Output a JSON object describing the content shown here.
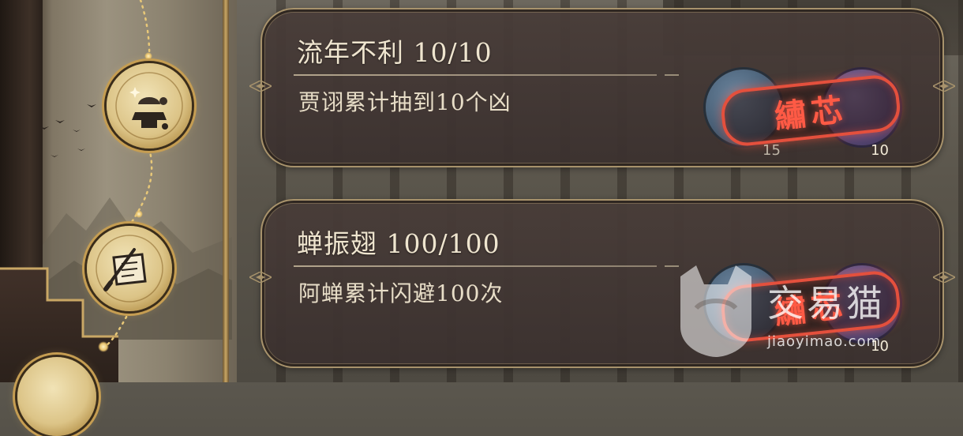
{
  "achievements": [
    {
      "title": "流年不利 10/10",
      "description": "贾诩累计抽到10个凶",
      "reward_stamp": "繡芯",
      "reward_count_left": "15",
      "reward_count_right": "10"
    },
    {
      "title": "蝉振翅 100/100",
      "description": "阿蝉累计闪避100次",
      "reward_stamp": "繡芯",
      "reward_count_left": "",
      "reward_count_right": "10"
    }
  ],
  "watermark": {
    "brand": "交易猫",
    "url": "jiaoyimao.com"
  },
  "colors": {
    "card_border": "#a8936c",
    "stamp_red": "#e4503d",
    "title_text": "#efe5cf",
    "node_gold": "#c59d52"
  },
  "icons": [
    "turtle-statue-icon",
    "scroll-brush-icon"
  ]
}
